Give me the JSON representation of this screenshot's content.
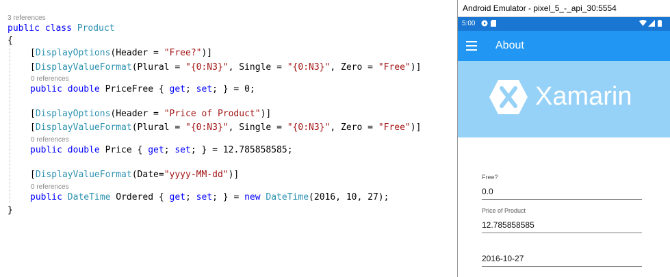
{
  "editor": {
    "class_refs": "3 references",
    "l1": {
      "kw": "public class ",
      "type": "Product"
    },
    "open_brace": "{",
    "a1": {
      "open": "[",
      "attr": "DisplayOptions",
      "p1": "(Header = ",
      "s1": "\"Free?\"",
      "p2": ")]"
    },
    "a2": {
      "open": "[",
      "attr": "DisplayValueFormat",
      "p1": "(Plural = ",
      "s1": "\"{0:N3}\"",
      "p2": ", Single = ",
      "s2": "\"{0:N3}\"",
      "p3": ", Zero = ",
      "s3": "\"Free\"",
      "p4": ")]"
    },
    "refs1": "0 references",
    "prop1": {
      "kw": "public double ",
      "name": "PriceFree { ",
      "get": "get",
      "sep": "; ",
      "set": "set",
      "rest": "; } = 0;"
    },
    "a3": {
      "open": "[",
      "attr": "DisplayOptions",
      "p1": "(Header = ",
      "s1": "\"Price of Product\"",
      "p2": ")]"
    },
    "a4": {
      "open": "[",
      "attr": "DisplayValueFormat",
      "p1": "(Plural = ",
      "s1": "\"{0:N3}\"",
      "p2": ", Single = ",
      "s2": "\"{0:N3}\"",
      "p3": ", Zero = ",
      "s3": "\"Free\"",
      "p4": ")]"
    },
    "refs2": "0 references",
    "prop2": {
      "kw": "public double ",
      "name": "Price { ",
      "get": "get",
      "sep": "; ",
      "set": "set",
      "rest": "; } = 12.785858585;"
    },
    "a5": {
      "open": "[",
      "attr": "DisplayValueFormat",
      "p1": "(Date=",
      "s1": "\"yyyy-MM-dd\"",
      "p2": ")]"
    },
    "refs3": "0 references",
    "prop3": {
      "kw": "public ",
      "type": "DateTime",
      "name": " Ordered { ",
      "get": "get",
      "sep": "; ",
      "set": "set",
      "mid": "; } = ",
      "new": "new ",
      "type2": "DateTime",
      "rest": "(2016, 10, 27);"
    },
    "close_brace": "}"
  },
  "emulator": {
    "window_title": "Android Emulator - pixel_5_-_api_30:5554",
    "status_time": "5:00",
    "app_title": "About",
    "brand": "Xamarin",
    "fields": [
      {
        "label": "Free?",
        "value": "0.0"
      },
      {
        "label": "Price of Product",
        "value": "12.785858585"
      },
      {
        "label": "",
        "value": "2016-10-27"
      }
    ]
  },
  "colors": {
    "keyword": "#0000ff",
    "type": "#2b91af",
    "string": "#a31515",
    "appbar": "#2196f3",
    "statusbar": "#1976d2",
    "banner": "#96d1f7"
  }
}
